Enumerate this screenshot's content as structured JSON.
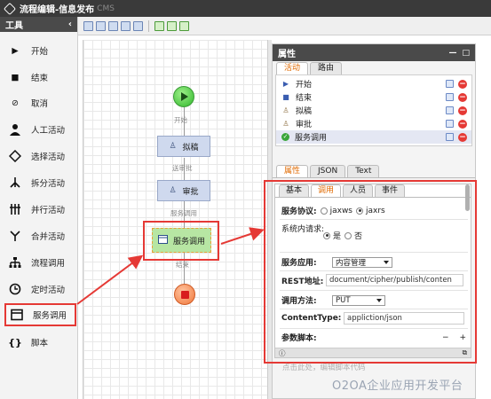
{
  "window": {
    "title": "流程编辑-信息发布",
    "subtitle": "CMS"
  },
  "tools": {
    "header": "工具",
    "items": [
      {
        "label": "开始",
        "icon": "play-icon"
      },
      {
        "label": "结束",
        "icon": "stop-icon"
      },
      {
        "label": "取消",
        "icon": "cancel-icon"
      },
      {
        "label": "人工活动",
        "icon": "person-icon"
      },
      {
        "label": "选择活动",
        "icon": "choice-icon"
      },
      {
        "label": "拆分活动",
        "icon": "split-icon"
      },
      {
        "label": "并行活动",
        "icon": "parallel-icon"
      },
      {
        "label": "合并活动",
        "icon": "merge-icon"
      },
      {
        "label": "流程调用",
        "icon": "process-call-icon"
      },
      {
        "label": "定时活动",
        "icon": "timer-icon"
      },
      {
        "label": "服务调用",
        "icon": "service-icon",
        "active": true
      },
      {
        "label": "脚本",
        "icon": "script-icon"
      }
    ]
  },
  "diagram": {
    "start_label": "开始",
    "node1": "拟稿",
    "edge2": "送审批",
    "node2": "审批",
    "edge3": "服务调用",
    "node3": "服务调用",
    "edge4": "结束"
  },
  "props": {
    "header": "属性",
    "tabs": [
      "活动",
      "路由"
    ],
    "activities": [
      {
        "label": "开始",
        "icon": "play-icon"
      },
      {
        "label": "结束",
        "icon": "stop-icon"
      },
      {
        "label": "拟稿",
        "icon": "person-icon"
      },
      {
        "label": "审批",
        "icon": "person-icon"
      },
      {
        "label": "服务调用",
        "icon": "check-icon",
        "selected": true
      }
    ],
    "tabs2": [
      "属性",
      "JSON",
      "Text"
    ],
    "form_tabs": [
      "基本",
      "调用",
      "人员",
      "事件"
    ],
    "fields": {
      "protocol_label": "服务协议:",
      "protocol_opt1": "jaxws",
      "protocol_opt2": "jaxrs",
      "internal_label": "系统内请求:",
      "internal_opt1": "是",
      "internal_opt2": "否",
      "app_label": "服务应用:",
      "app_value": "内容管理",
      "rest_label": "REST地址:",
      "rest_value": "document/cipher/publish/conten",
      "method_label": "调用方法:",
      "method_value": "PUT",
      "ctype_label": "ContentType:",
      "ctype_value": "appliction/json",
      "script_label": "参数脚本:",
      "minus": "−",
      "plus": "+",
      "info": "ⓘ"
    },
    "hint": "点击此处，编辑脚本代码"
  },
  "watermark": "O2OA企业应用开发平台",
  "colors": {
    "highlight": "#e53935",
    "dark": "#3a3a3a"
  }
}
